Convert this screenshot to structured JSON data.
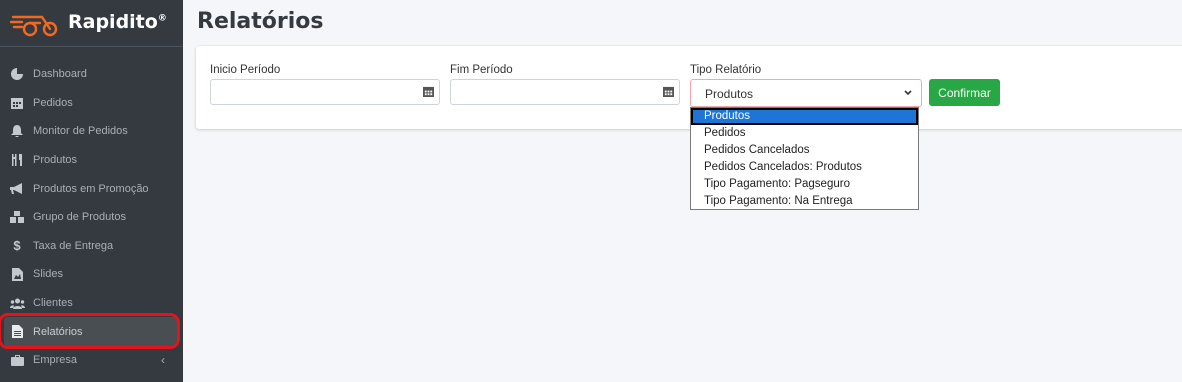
{
  "brand": {
    "name": "Rapidito",
    "mark": "®"
  },
  "colors": {
    "sidebar_bg": "#343a40",
    "accent_green": "#28a745",
    "select_blue": "#1e75d6",
    "highlight_red": "#e3151a"
  },
  "sidebar": {
    "items": [
      {
        "label": "Dashboard",
        "icon": "pie-chart-icon"
      },
      {
        "label": "Pedidos",
        "icon": "calendar-icon"
      },
      {
        "label": "Monitor de Pedidos",
        "icon": "bell-icon"
      },
      {
        "label": "Produtos",
        "icon": "utensils-icon"
      },
      {
        "label": "Produtos em Promoção",
        "icon": "megaphone-icon"
      },
      {
        "label": "Grupo de Produtos",
        "icon": "cubes-icon"
      },
      {
        "label": "Taxa de Entrega",
        "icon": "dollar-icon"
      },
      {
        "label": "Slides",
        "icon": "image-file-icon"
      },
      {
        "label": "Clientes",
        "icon": "users-icon"
      },
      {
        "label": "Relatórios",
        "icon": "file-icon",
        "active": true
      },
      {
        "label": "Empresa",
        "icon": "briefcase-icon",
        "chevron": "‹"
      }
    ]
  },
  "page": {
    "title": "Relatórios"
  },
  "form": {
    "start_label": "Inicio Período",
    "end_label": "Fim Período",
    "type_label": "Tipo Relatório",
    "type_value": "Produtos",
    "confirm_label": "Confirmar",
    "options": [
      "Produtos",
      "Pedidos",
      "Pedidos Cancelados",
      "Pedidos Cancelados: Produtos",
      "Tipo Pagamento: Pagseguro",
      "Tipo Pagamento: Na Entrega"
    ]
  }
}
